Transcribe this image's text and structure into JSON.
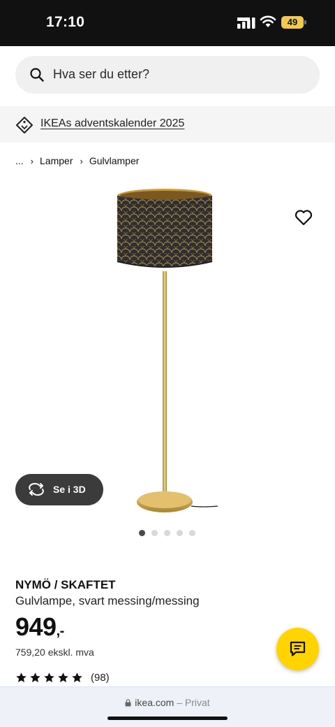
{
  "status": {
    "time": "17:10",
    "battery": "49"
  },
  "search": {
    "placeholder": "Hva ser du etter?"
  },
  "promo": {
    "label": "IKEAs adventskalender 2025"
  },
  "breadcrumb": {
    "items": [
      "...",
      "Lamper",
      "Gulvlamper"
    ]
  },
  "gallery": {
    "view3d_label": "Se i 3D",
    "slide_count": 5,
    "active_slide": 1
  },
  "product": {
    "name": "NYMÖ / SKAFTET",
    "description": "Gulvlampe, svart messing/messing",
    "price": "949",
    "price_suffix": ",-",
    "price_excl_vat": "759,20 ekskl. mva",
    "rating_stars": 5,
    "review_count": "(98)"
  },
  "browser": {
    "domain": "ikea.com",
    "mode": "– Privat"
  },
  "colors": {
    "accent_yellow": "#ffd400",
    "status_bar": "#111111"
  },
  "icons": [
    "search-icon",
    "tag-icon",
    "heart-icon",
    "rotate-3d-icon",
    "star-icon",
    "chat-icon",
    "lock-icon",
    "signal-icon",
    "wifi-icon"
  ]
}
